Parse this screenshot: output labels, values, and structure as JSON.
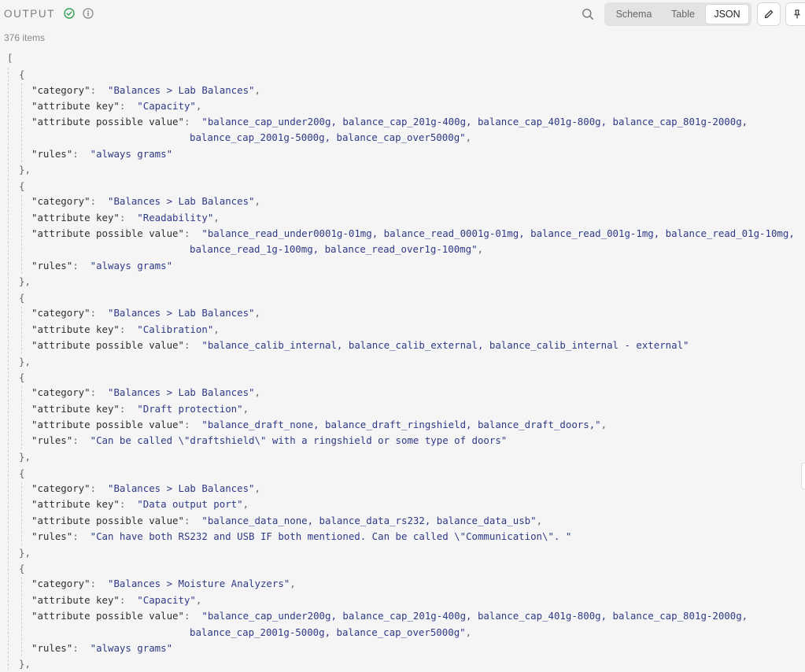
{
  "panel": {
    "title": "OUTPUT",
    "status_icon": "check-circle-icon",
    "info_icon": "info-icon",
    "item_count": "376 items"
  },
  "toolbar": {
    "search_icon": "search-icon",
    "views": [
      "Schema",
      "Table",
      "JSON"
    ],
    "active_view": "JSON",
    "edit_icon": "pencil-icon",
    "pin_icon": "pin-icon"
  },
  "colors": {
    "background": "#f5f5f5",
    "string_value": "#2f3a87",
    "success": "#2e9e55"
  },
  "json": {
    "open_bracket": "[",
    "items": [
      {
        "category": "\"Balances > Lab Balances\"",
        "attribute_key": "\"Capacity\"",
        "value_line1": "\"balance_cap_under200g, balance_cap_201g-400g, balance_cap_401g-800g, balance_cap_801g-2000g,",
        "value_line2": "balance_cap_2001g-5000g, balance_cap_over5000g\"",
        "rules": "\"always grams\""
      },
      {
        "category": "\"Balances > Lab Balances\"",
        "attribute_key": "\"Readability\"",
        "value_line1": "\"balance_read_under0001g-01mg, balance_read_0001g-01mg, balance_read_001g-1mg, balance_read_01g-10mg,",
        "value_line2": "balance_read_1g-100mg, balance_read_over1g-100mg\"",
        "rules": "\"always grams\""
      },
      {
        "category": "\"Balances > Lab Balances\"",
        "attribute_key": "\"Calibration\"",
        "value_line1": "\"balance_calib_internal, balance_calib_external, balance_calib_internal - external\""
      },
      {
        "category": "\"Balances > Lab Balances\"",
        "attribute_key": "\"Draft protection\"",
        "value_line1": "\"balance_draft_none, balance_draft_ringshield, balance_draft_doors,\"",
        "rules": "\"Can be called \\\"draftshield\\\" with a ringshield or some type of doors\""
      },
      {
        "category": "\"Balances > Lab Balances\"",
        "attribute_key": "\"Data output port\"",
        "value_line1": "\"balance_data_none, balance_data_rs232, balance_data_usb\"",
        "rules": "\"Can have both RS232 and USB IF both mentioned. Can be called \\\"Communication\\\". \""
      },
      {
        "category": "\"Balances > Moisture Analyzers\"",
        "attribute_key": "\"Capacity\"",
        "value_line1": "\"balance_cap_under200g, balance_cap_201g-400g, balance_cap_401g-800g, balance_cap_801g-2000g,",
        "value_line2": "balance_cap_2001g-5000g, balance_cap_over5000g\"",
        "rules": "\"always grams\""
      }
    ]
  }
}
